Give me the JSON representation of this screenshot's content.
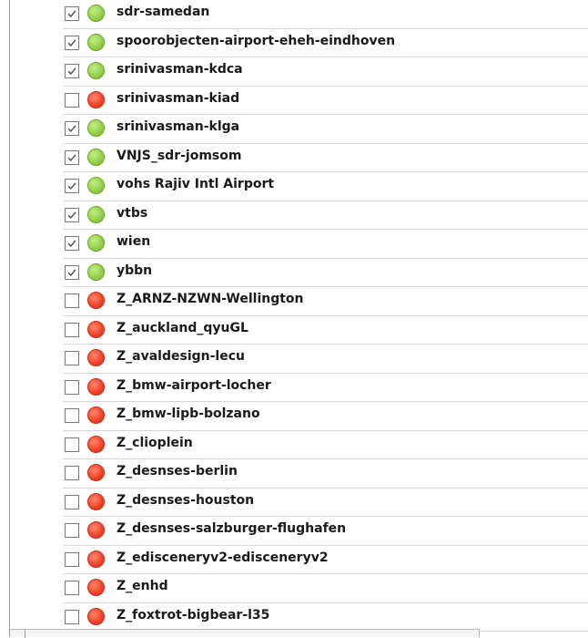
{
  "airports": [
    {
      "name": "sdr-samedan",
      "checked": true,
      "status": "green"
    },
    {
      "name": "spoorobjecten-airport-eheh-eindhoven",
      "checked": true,
      "status": "green"
    },
    {
      "name": "srinivasman-kdca",
      "checked": true,
      "status": "green"
    },
    {
      "name": "srinivasman-kiad",
      "checked": false,
      "status": "red"
    },
    {
      "name": "srinivasman-klga",
      "checked": true,
      "status": "green"
    },
    {
      "name": "VNJS_sdr-jomsom",
      "checked": true,
      "status": "green"
    },
    {
      "name": "vohs Rajiv Intl Airport",
      "checked": true,
      "status": "green"
    },
    {
      "name": "vtbs",
      "checked": true,
      "status": "green"
    },
    {
      "name": "wien",
      "checked": true,
      "status": "green"
    },
    {
      "name": "ybbn",
      "checked": true,
      "status": "green"
    },
    {
      "name": "Z_ARNZ-NZWN-Wellington",
      "checked": false,
      "status": "red"
    },
    {
      "name": "Z_auckland_qyuGL",
      "checked": false,
      "status": "red"
    },
    {
      "name": "Z_avaldesign-lecu",
      "checked": false,
      "status": "red"
    },
    {
      "name": "Z_bmw-airport-locher",
      "checked": false,
      "status": "red"
    },
    {
      "name": "Z_bmw-lipb-bolzano",
      "checked": false,
      "status": "red"
    },
    {
      "name": "Z_clioplein",
      "checked": false,
      "status": "red"
    },
    {
      "name": "Z_desnses-berlin",
      "checked": false,
      "status": "red"
    },
    {
      "name": "Z_desnses-houston",
      "checked": false,
      "status": "red"
    },
    {
      "name": "Z_desnses-salzburger-flughafen",
      "checked": false,
      "status": "red"
    },
    {
      "name": "Z_edisceneryv2-edisceneryv2",
      "checked": false,
      "status": "red"
    },
    {
      "name": "Z_enhd",
      "checked": false,
      "status": "red"
    },
    {
      "name": "Z_foxtrot-bigbear-l35",
      "checked": false,
      "status": "red"
    }
  ],
  "colors": {
    "status_green": "#95d24b",
    "status_red": "#f3442a",
    "check_mark": "#4a4a4a"
  }
}
